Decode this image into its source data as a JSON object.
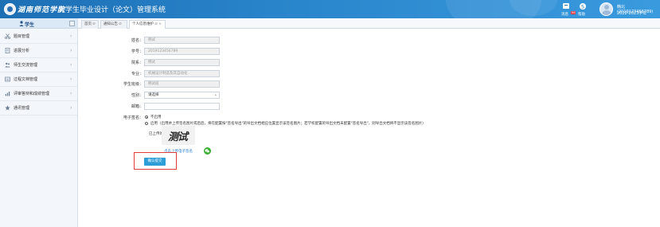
{
  "header": {
    "logo_text": "湖南师范学院",
    "title": "大学生毕业设计（论文）管理系统",
    "icons": [
      {
        "name": "notification-icon",
        "label": "消息",
        "badge": "99"
      },
      {
        "name": "help-icon",
        "label": "帮助"
      }
    ],
    "user_name": "韩北(2019123456789)",
    "academic_year": "2022-2023学年"
  },
  "sidebar": {
    "title": "学生",
    "items": [
      {
        "label": "题目管理",
        "icon": "scissors-icon"
      },
      {
        "label": "进展分析",
        "icon": "document-icon"
      },
      {
        "label": "师生交流管理",
        "icon": "people-icon"
      },
      {
        "label": "过程文档管理",
        "icon": "folder-icon"
      },
      {
        "label": "评审答辩和成绩管理",
        "icon": "chart-icon"
      },
      {
        "label": "通讯管理",
        "icon": "star-icon"
      }
    ]
  },
  "tabs": [
    {
      "label": "首页",
      "close": "⊘"
    },
    {
      "label": "通知公告",
      "close": "⊘"
    },
    {
      "label": "个人信息维护",
      "close": "⊘ ×"
    }
  ],
  "form": {
    "name_label": "姓名：",
    "name_value": "韩试",
    "student_id_label": "学号：",
    "student_id_value": "2019123456789",
    "department_label": "院系：",
    "department_value": "韩试",
    "major_label": "专业：",
    "major_value": "机械设计制造及其自动化",
    "class_label": "学生班级：",
    "class_value": "韩试班",
    "gender_label": "性别：",
    "gender_value": "请选择",
    "email_label": "邮箱：",
    "email_value": "",
    "signature_label": "电子签名：",
    "option_disable": "不启用",
    "option_enable": "启用（启用并上传签名图片或后后，将在配置按\"签名导出\"的导出文档相应位置显示该签名图片；若学校配置的导出文档未配置\"签名导出\"，则导出文档将不显示该签名图片）",
    "uploaded_label": "已上传的签名图片：",
    "signature_text": "测试",
    "upload_link": "点击上传电子签名",
    "confirm_button": "确认提交"
  }
}
